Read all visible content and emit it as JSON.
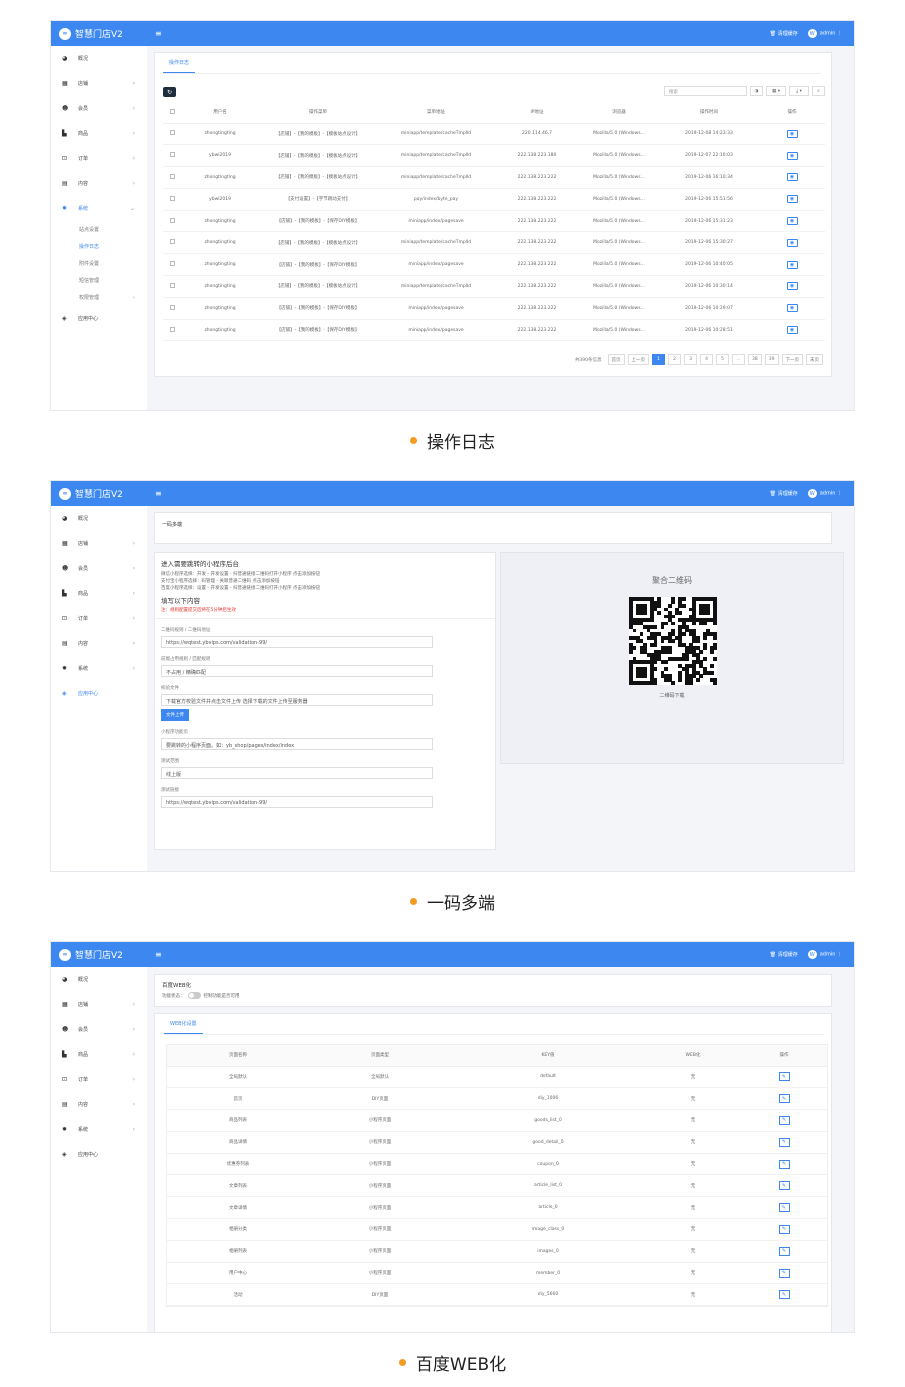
{
  "app": {
    "brand": "智慧门店V2",
    "clear_cache": "清理缓存",
    "user": "admin",
    "avatar_letter": "W"
  },
  "nav": {
    "overview": "概况",
    "shop": "店铺",
    "member": "会员",
    "goods": "商品",
    "order": "订单",
    "content": "内容",
    "system": "系统",
    "app_center": "应用中心"
  },
  "shot1": {
    "subnav": [
      "站点设置",
      "操作日志",
      "附件设置",
      "短信管理",
      "权限管理"
    ],
    "tab": "操作日志",
    "search_placeholder": "搜索",
    "columns": [
      "用户名",
      "操作菜单",
      "菜单地址",
      "IP地址",
      "浏览器",
      "操作时间",
      "操作"
    ],
    "rows": [
      [
        "zhongtingting",
        "【店铺】-【我的模板】-【模板站点设计】",
        "miniapp/template/cacheTmplId",
        "220.114.46.7",
        "Mozilla/5.0 (Windows...",
        "2019-12-08 14:23:33"
      ],
      [
        "ybwl2019",
        "【店铺】-【我的模板】-【模板站点设计】",
        "miniapp/template/cacheTmplId",
        "222.138.223.180",
        "Mozilla/5.0 (Windows...",
        "2019-12-07 22:10:03"
      ],
      [
        "zhongtingting",
        "【店铺】-【我的模板】-【模板站点设计】",
        "miniapp/template/cacheTmplId",
        "222.138.223.222",
        "Mozilla/5.0 (Windows...",
        "2019-12-06 16:10:34"
      ],
      [
        "ybwl2019",
        "【支付设置】-【字节跳动支付】",
        "pay/index/byte_pay",
        "222.138.223.222",
        "Mozilla/5.0 (Windows...",
        "2019-12-06 15:51:56"
      ],
      [
        "zhongtingting",
        "【店铺】-【我的模板】-【保存DIY模板】",
        "miniapp/index/pagesave",
        "222.138.223.222",
        "Mozilla/5.0 (Windows...",
        "2019-12-06 15:31:23"
      ],
      [
        "zhongtingting",
        "【店铺】-【我的模板】-【模板站点设计】",
        "miniapp/template/cacheTmplId",
        "222.138.223.222",
        "Mozilla/5.0 (Windows...",
        "2019-12-06 15:30:27"
      ],
      [
        "zhongtingting",
        "【店铺】-【我的模板】-【保存DIY模板】",
        "miniapp/index/pagesave",
        "222.138.223.222",
        "Mozilla/5.0 (Windows...",
        "2019-12-06 10:40:05"
      ],
      [
        "zhongtingting",
        "【店铺】-【我的模板】-【模板站点设计】",
        "miniapp/template/cacheTmplId",
        "222.138.223.222",
        "Mozilla/5.0 (Windows...",
        "2019-12-06 10:30:14"
      ],
      [
        "zhongtingting",
        "【店铺】-【我的模板】-【保存DIY模板】",
        "miniapp/index/pagesave",
        "222.138.223.222",
        "Mozilla/5.0 (Windows...",
        "2019-12-06 10:29:07"
      ],
      [
        "zhongtingting",
        "【店铺】-【我的模板】-【保存DIY模板】",
        "miniapp/index/pagesave",
        "222.138.223.222",
        "Mozilla/5.0 (Windows...",
        "2019-12-06 10:28:51"
      ]
    ],
    "pager": {
      "total": "共390条信息",
      "first": "首页",
      "prev": "上一页",
      "pages": [
        "1",
        "2",
        "3",
        "4",
        "5",
        "..",
        "38",
        "39"
      ],
      "next": "下一页",
      "last": "末页"
    },
    "caption": "操作日志"
  },
  "shot2": {
    "title": "一码多端",
    "intro_title": "进入需要跳转的小程序后台",
    "intro_lines": [
      "微信小程序选择：开发 - 开发设置 - 扫普通链接二维码打开小程序 点击添加按钮",
      "支付宝小程序选择：码管理 - 关联普通二维码 点击添加按钮",
      "百度小程序选择：设置 - 开发设置 - 扫普通链接二维码打开小程序 点击添加按钮"
    ],
    "fill_title": "填写以下内容",
    "warn": "注：规则配置提交后将在5分钟后生效",
    "fields": [
      {
        "label": "二维码规则 / 二维码地址",
        "value": "https://wqtest.ybvips.com/validation-99/"
      },
      {
        "label": "前缀占用规则 / 匹配规则",
        "value": "不占用 / 精确匹配"
      },
      {
        "label": "校验文件",
        "value": "下载官方校验文件并点击文件上传 选择下载的文件上传至服务器"
      },
      {
        "label": "小程序功能页",
        "value": "要跳转的小程序页面。如：yb_shop/pages/index/index"
      },
      {
        "label": "测试范围",
        "value": "线上版"
      },
      {
        "label": "测试链接",
        "value": "https://wqtest.ybvips.com/validation-99/"
      }
    ],
    "upload_btn": "文件上传",
    "qr_title": "聚合二维码",
    "qr_download": "二维码下载",
    "caption": "一码多端"
  },
  "shot3": {
    "title": "百度WEB化",
    "status_label": "功能状态：",
    "status_hint": "控制功能是否可用",
    "tab": "WEB化设置",
    "columns": [
      "页面名称",
      "页面类型",
      "KEY值",
      "WEB化",
      "操作"
    ],
    "rows": [
      [
        "全局默认",
        "全局默认",
        "default",
        "无"
      ],
      [
        "首页",
        "DIY页面",
        "diy_1006",
        "无"
      ],
      [
        "商品列表",
        "小程序页面",
        "goods_list_0",
        "无"
      ],
      [
        "商品详情",
        "小程序页面",
        "good_detail_0",
        "无"
      ],
      [
        "优惠券列表",
        "小程序页面",
        "coupon_0",
        "无"
      ],
      [
        "文章列表",
        "小程序页面",
        "article_list_0",
        "无"
      ],
      [
        "文章详情",
        "小程序页面",
        "article_0",
        "无"
      ],
      [
        "相册分类",
        "小程序页面",
        "image_class_0",
        "无"
      ],
      [
        "相册列表",
        "小程序页面",
        "images_0",
        "无"
      ],
      [
        "用户中心",
        "小程序页面",
        "member_0",
        "无"
      ],
      [
        "活动",
        "DIY页面",
        "diy_5660",
        "无"
      ]
    ],
    "caption": "百度WEB化"
  }
}
